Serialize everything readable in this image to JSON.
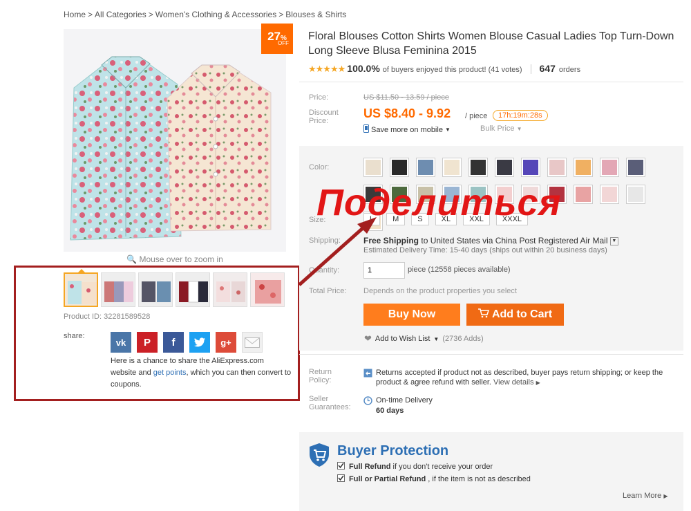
{
  "breadcrumb": {
    "items": [
      "Home",
      "All Categories",
      "Women's Clothing & Accessories",
      "Blouses & Shirts"
    ],
    "separator": ">"
  },
  "gallery": {
    "discount_percent": "27",
    "discount_sign": "%",
    "discount_off": "OFF",
    "zoom_hint": "Mouse over to zoom in",
    "product_id_label": "Product ID:",
    "product_id": "32281589528"
  },
  "share": {
    "label": "share:",
    "icons": [
      "vk-icon",
      "pinterest-icon",
      "facebook-icon",
      "twitter-icon",
      "google-plus-icon",
      "email-icon"
    ],
    "text_before": "Here is a chance to share the AliExpress.com website and ",
    "link": "get points",
    "text_after": ", which you can then convert to coupons."
  },
  "overlay_text": "Поделиться",
  "product": {
    "title": "Floral Blouses Cotton Shirts Women Blouse Casual Ladies Top Turn-Down Long Sleeve Blusa Feminina 2015",
    "rating_percent": "100.0%",
    "rating_text": "of buyers enjoyed this product! (41 votes)",
    "orders_count": "647",
    "orders_label": "orders"
  },
  "price": {
    "price_label": "Price:",
    "original": "US $11.50 - 13.59 / piece",
    "discount_label_1": "Discount",
    "discount_label_2": "Price:",
    "current": "US $8.40 - 9.92",
    "per_piece": "/ piece",
    "timer": "17h:19m:28s",
    "mobile_link": "Save more on mobile",
    "bulk_price": "Bulk Price"
  },
  "options": {
    "color_label": "Color:",
    "size_label": "Size:",
    "sizes": [
      "L",
      "M",
      "S",
      "XL",
      "XXL",
      "XXXL"
    ],
    "shipping_label": "Shipping:",
    "shipping_bold": "Free Shipping",
    "shipping_rest": "to  United States via China Post Registered Air Mail",
    "shipping_sub": "Estimated Delivery Time: 15-40 days (ships out within 20 business days)",
    "quantity_label": "Quantity:",
    "quantity_value": "1",
    "quantity_avail": "piece (12558 pieces available)",
    "total_label": "Total Price:",
    "total_text": "Depends on the product properties you select",
    "buy_now": "Buy Now",
    "add_to_cart": "Add to Cart",
    "wishlist": "Add to Wish List",
    "wishlist_count": "(2736 Adds)"
  },
  "policies": {
    "return_label_1": "Return",
    "return_label_2": "Policy:",
    "return_text": "Returns accepted if product not as described, buyer pays return shipping; or keep the product & agree refund with seller.",
    "view_details": "View details",
    "seller_label_1": "Seller",
    "seller_label_2": "Guarantees:",
    "ontime": "On-time Delivery",
    "days": "60 days"
  },
  "buyer_protection": {
    "title": "Buyer Protection",
    "item1_bold": "Full Refund",
    "item1_rest": " if you don't receive your order",
    "item2_bold": "Full or Partial Refund",
    "item2_rest": " , if the item is not as described",
    "learn_more": "Learn More"
  },
  "colors": {
    "accent_orange": "#ff6a00",
    "price_orange": "#ff6a00",
    "link_blue": "#2e6fb5",
    "highlight_red": "#a31f1f",
    "overlay_red": "#e21616",
    "star": "#f5a623"
  }
}
